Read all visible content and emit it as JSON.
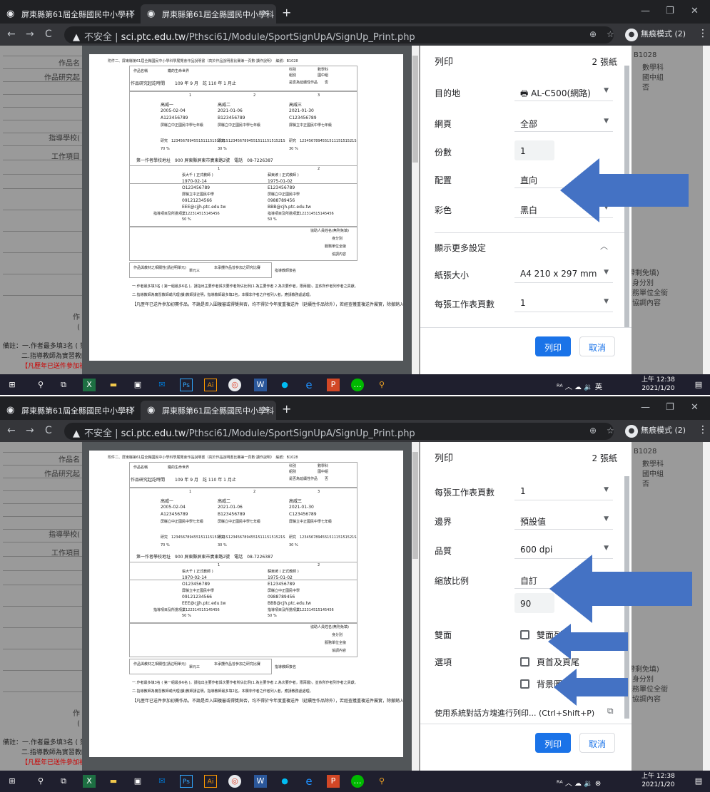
{
  "browser": {
    "tab1_title": "屏東縣第61屆全縣國民中小學科",
    "tab2_title": "屏東縣第61屆全縣國民中小學科",
    "new_tab": "+",
    "insecure_label": "不安全",
    "address_host": "sci.ptc.edu.tw",
    "address_path": "/Pthsci61/Module/SportSignUpA/SignUp_Print.php",
    "incognito_label": "無痕模式 (2)"
  },
  "background_page": {
    "left_labels": [
      "作品名",
      "作品研究起",
      "",
      "",
      "",
      "",
      "",
      "",
      "指導學校(",
      "工作項目",
      "",
      "",
      "",
      "",
      "",
      "",
      "",
      "",
      "",
      "",
      "作",
      "("
    ],
    "footer_notes": [
      "備註：一.作者最多填3名 ( 第",
      "二.指導教師為實習教師",
      "【凡歷年已送件參加初"
    ],
    "right_labels": [
      "B1028",
      "數學科",
      "國中組",
      "否"
    ],
    "right_labels_lower": [
      "(帶剩免填)",
      "身分別",
      "服務單位全銜",
      "協調內容"
    ]
  },
  "print_sheet": {
    "header": "附件二、屏東縣第61屆全縣國民中小學科學展覽會作品說明書（高於作品說明書比賽兼一頁數‧讀作說明）　編號：B1028",
    "work_name_label": "作品名稱",
    "work_name": "鐵的生命世界",
    "subject_label": "科別",
    "subject": "數學科",
    "group_label": "組別",
    "group": "國中組",
    "period_label": "作品研究起訖時間",
    "period": "109 年 9 月　訖 110 年 1 月止",
    "continuing_label": "是否為延續性作品",
    "continuing": "否",
    "author_cols": [
      "1",
      "2",
      "3"
    ],
    "authors": [
      "高威一",
      "高威二",
      "高威三"
    ],
    "births": [
      "2005-02-04",
      "2021-01-06",
      "2021-01-30"
    ],
    "ids": [
      "A123456789",
      "B123456789",
      "C123456789"
    ],
    "schools": [
      "屏縣立中正國民中學七年級",
      "屏縣立中正國民中學七年級",
      "屏縣立中正國民中學七年級"
    ],
    "work_items": [
      "研究　123456789455151115151521S",
      "研究　123456789455151115151521S",
      "研究　123456789455151115151521S"
    ],
    "percents": [
      "70 %",
      "30 %",
      "30 %"
    ],
    "first_school": "第一作者學校地址　900 屏東縣屏東市廣東路2號　電話　08-7226387",
    "teacher_cols": [
      "1",
      "2"
    ],
    "teacher_names": [
      "張大千 ( 正式教師 )",
      "蘇東坡 ( 正式教師 )"
    ],
    "teacher_births": [
      "1970-02-14",
      "1975-01-02"
    ],
    "teacher_ids": [
      "O123456789",
      "E123456789"
    ],
    "teacher_schools": [
      "屏縣立中正國民中學",
      "屏縣立中正國民中學"
    ],
    "teacher_phones": [
      "09121234566",
      "0988789456"
    ],
    "teacher_emails": [
      "EEE@cjjh.ptc.edu.tw",
      "BBB@cjh.ptc.edu.tw"
    ],
    "teacher_items": [
      "指導項目及所擔項業122314515145456",
      "指導項目及所擔項業122314515145456"
    ],
    "teacher_percents": [
      "50 %",
      "50 %"
    ],
    "side_labels": [
      "協助人員姓名(無則免填)",
      "身分別",
      "服務單位全銜",
      "協調內容"
    ],
    "bottom_labels": [
      "作品與教材之相關性(請註明單元)",
      "單元三",
      "本承攬作品曾參加之研究比賽",
      "指導教師簽名"
    ],
    "notes": [
      "一.作者最多填3名 ( 第一組最多6名 )，請指出主要作者與次要作者所佔比例(1.為主要作者 2.為次要作者，限兩層)，並依所作者列作者之貢獻。",
      "二.指導教師為實習教師或代理(課)教師請註明，指導教師最多填2名，本欄非作者之作者列入者，應請教務處處理。",
      "【凡歷年已送件參加初賽作品，不論是否入圍複審或得獎與否，均不得於今年度重複送件（延續性作品除外），若經查獲重複送件屬實，除撤銷入圍資格並從嚴辦理】"
    ]
  },
  "print_panel_1": {
    "title": "列印",
    "sheet_count": "2 張紙",
    "destination_label": "目的地",
    "destination_value": "AL-C500(網路)",
    "pages_label": "網頁",
    "pages_value": "全部",
    "copies_label": "份數",
    "copies_value": "1",
    "layout_label": "配置",
    "layout_value": "直向",
    "color_label": "彩色",
    "color_value": "黑白",
    "more_settings_label": "顯示更多設定",
    "paper_size_label": "紙張大小",
    "paper_size_value": "A4 210 x 297 mm",
    "pages_per_sheet_label": "每張工作表頁數",
    "pages_per_sheet_value": "1",
    "margins_partial": "邊界",
    "margins_partial_value": "預設值"
  },
  "print_panel_2": {
    "title": "列印",
    "sheet_count": "2 張紙",
    "pages_per_sheet_label": "每張工作表頁數",
    "pages_per_sheet_value": "1",
    "margins_label": "邊界",
    "margins_value": "預設值",
    "quality_label": "品質",
    "quality_value": "600 dpi",
    "scale_label": "縮放比例",
    "scale_value": "自訂",
    "scale_number": "90",
    "duplex_label": "雙面",
    "duplex_option": "雙面列印",
    "options_label": "選項",
    "option_headers": "頁首及頁尾",
    "option_backgrounds": "背景圖形",
    "system_dialog_label": "使用系統對話方塊進行列印... (Ctrl+Shift+P)"
  },
  "buttons": {
    "print": "列印",
    "cancel": "取消"
  },
  "taskbar": {
    "ime_label": "英",
    "time": "上午 12:38",
    "date": "2021/1/20"
  },
  "colors": {
    "arrow": "#4472c4",
    "accent": "#1a73e8",
    "taskbar": "#1f1f2e"
  }
}
